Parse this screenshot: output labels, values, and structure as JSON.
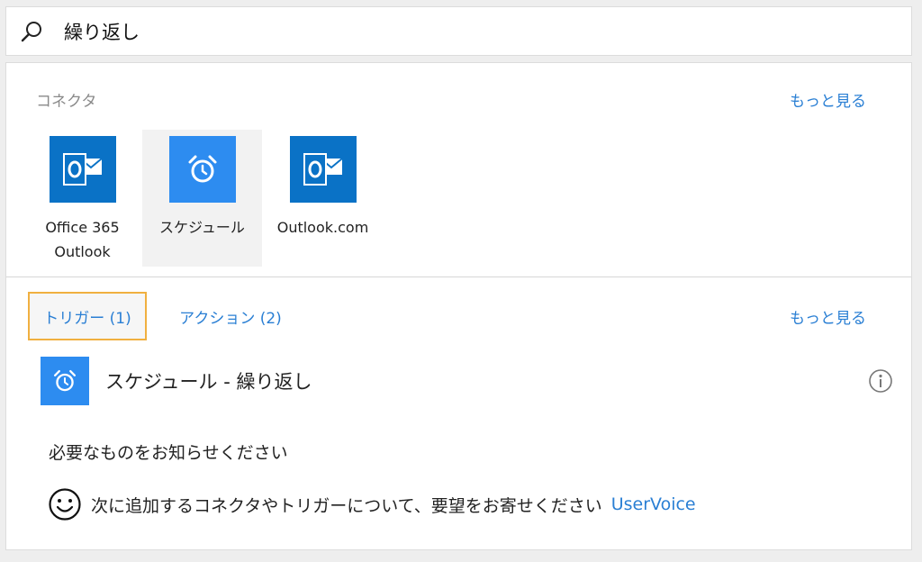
{
  "search": {
    "value": "繰り返し",
    "icon": "search-icon"
  },
  "connectors_section": {
    "label": "コネクタ",
    "see_more": "もっと見る",
    "items": [
      {
        "label": "Office 365\nOutlook",
        "icon": "outlook-icon",
        "selected": false
      },
      {
        "label": "スケジュール",
        "icon": "alarm-clock-icon",
        "selected": true
      },
      {
        "label": "Outlook.com",
        "icon": "outlook-icon",
        "selected": false
      }
    ]
  },
  "tabs": {
    "items": [
      {
        "label": "トリガー (1)",
        "active": true
      },
      {
        "label": "アクション (2)",
        "active": false
      }
    ],
    "see_more": "もっと見る"
  },
  "results": [
    {
      "label": "スケジュール - 繰り返し",
      "icon": "alarm-clock-icon",
      "info_icon": "info-icon"
    }
  ],
  "feedback": {
    "heading": "必要なものをお知らせください",
    "text": "次に追加するコネクタやトリガーについて、要望をお寄せください",
    "link": "UserVoice",
    "icon": "smiley-icon"
  },
  "colors": {
    "link": "#2a7fd4",
    "outlook_tile": "#0a72c6",
    "schedule_tile": "#2d8cf0",
    "active_tab_border": "#f0b040"
  }
}
